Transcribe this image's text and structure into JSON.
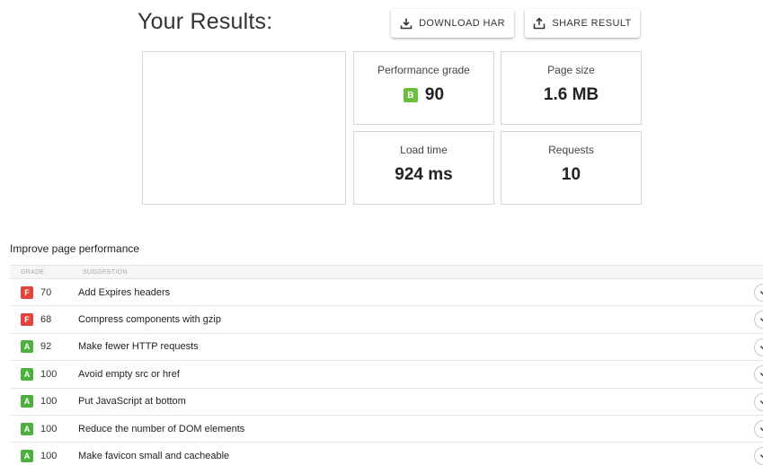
{
  "header": {
    "title": "Your Results:",
    "download_label": "DOWNLOAD HAR",
    "share_label": "SHARE RESULT"
  },
  "metrics": {
    "grade": {
      "label": "Performance grade",
      "letter": "B",
      "value": "90",
      "color": "#6bbf3f"
    },
    "page_size": {
      "label": "Page size",
      "value": "1.6 MB"
    },
    "load_time": {
      "label": "Load time",
      "value": "924 ms"
    },
    "requests": {
      "label": "Requests",
      "value": "10"
    }
  },
  "improve": {
    "title": "Improve page performance",
    "columns": {
      "grade": "GRADE",
      "suggestion": "SUGGESTION"
    },
    "rows": [
      {
        "letter": "F",
        "score": "70",
        "suggestion": "Add Expires headers",
        "color": "#e5423d"
      },
      {
        "letter": "F",
        "score": "68",
        "suggestion": "Compress components with gzip",
        "color": "#e5423d"
      },
      {
        "letter": "A",
        "score": "92",
        "suggestion": "Make fewer HTTP requests",
        "color": "#4caf3e"
      },
      {
        "letter": "A",
        "score": "100",
        "suggestion": "Avoid empty src or href",
        "color": "#4caf3e"
      },
      {
        "letter": "A",
        "score": "100",
        "suggestion": "Put JavaScript at bottom",
        "color": "#4caf3e"
      },
      {
        "letter": "A",
        "score": "100",
        "suggestion": "Reduce the number of DOM elements",
        "color": "#4caf3e"
      },
      {
        "letter": "A",
        "score": "100",
        "suggestion": "Make favicon small and cacheable",
        "color": "#4caf3e"
      }
    ]
  },
  "icons": {
    "download": "download-icon",
    "share": "share-icon",
    "expand": "chevron-down-icon"
  }
}
